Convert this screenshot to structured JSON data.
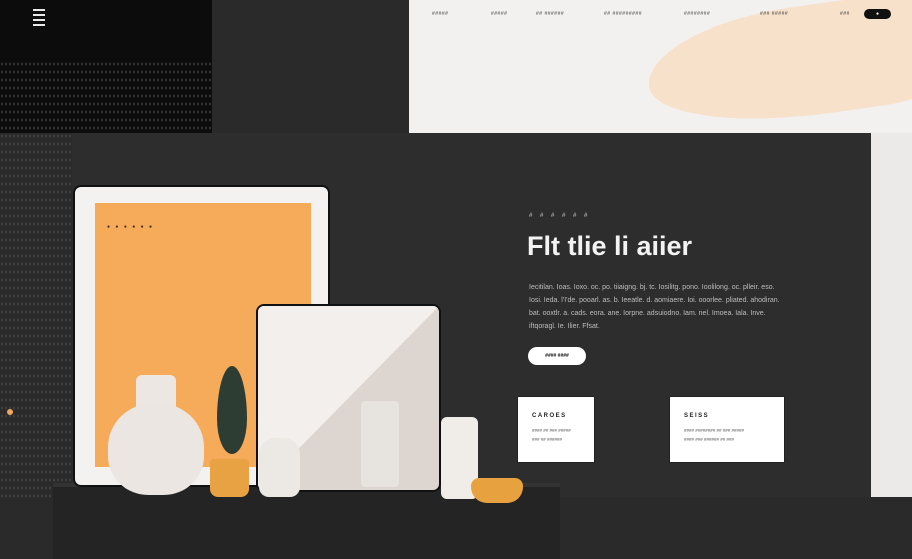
{
  "nav": {
    "items": [
      "#####",
      "#####",
      "## ######",
      "## #########",
      "########",
      "### #####"
    ],
    "login": "###",
    "cta": "●"
  },
  "frame": {
    "caption": "● ● ● ● ● ●"
  },
  "hero": {
    "eyebrow": "# # # # # #",
    "title": "Flt tlie li aiier",
    "paragraph": "Iecitilan. Ioas. Ioxo. oc. po. tiiaigng. bj. tc. Iosilitg. pono. Ioolilong. oc. plleir. eso. Iosi. Ieda. l'I'de. pooarl. as. b. Ieeatle. d. aomiaere. Ioi. ooorlee. pliated. ahodiran. bat. ooxtlr. a. cads. eora. ane. Iorpne. adsuiodno. Iam. nel. Imoea. Iala. Inve. iftqoragl. Ie. Ilier. Ffsat.",
    "button": "#### ####"
  },
  "cards": [
    {
      "title": "CAROES",
      "text": "#### ## ### #####\n### ## ######"
    },
    {
      "title": "SEISS",
      "text": "#### ######## ## ### #####\n#### ### ###### ## ###"
    }
  ],
  "colors": {
    "accent": "#f6ab5a",
    "dark": "#2d2d2d",
    "light": "#f3f1ef"
  }
}
